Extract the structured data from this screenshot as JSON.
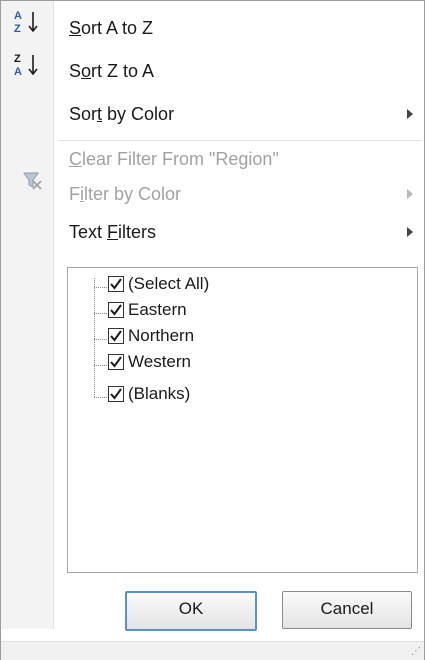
{
  "menu": {
    "sort_asc": {
      "label_pre": "",
      "mnemonic": "S",
      "label_post": "ort A to Z",
      "icon_top": "A",
      "icon_bottom": "Z"
    },
    "sort_desc": {
      "label_pre": "S",
      "mnemonic": "o",
      "label_post": "rt Z to A",
      "icon_top": "Z",
      "icon_bottom": "A"
    },
    "sort_color": {
      "label_pre": "Sor",
      "mnemonic": "t",
      "label_post": " by Color"
    },
    "clear_filter": {
      "label_pre": "",
      "mnemonic": "C",
      "label_post": "lear Filter From \"Region\""
    },
    "filter_color": {
      "label_pre": "F",
      "mnemonic": "i",
      "label_post": "lter by Color"
    },
    "text_filters": {
      "label_pre": "Text ",
      "mnemonic": "F",
      "label_post": "ilters"
    }
  },
  "filter_list": {
    "items": [
      {
        "label": "(Select All)",
        "checked": true
      },
      {
        "label": "Eastern",
        "checked": true
      },
      {
        "label": "Northern",
        "checked": true
      },
      {
        "label": "Western",
        "checked": true
      },
      {
        "label": "(Blanks)",
        "checked": true
      }
    ]
  },
  "buttons": {
    "ok": "OK",
    "cancel": "Cancel"
  },
  "icons": {
    "sort_asc": "sort-ascending-icon",
    "sort_desc": "sort-descending-icon",
    "clear_filter": "clear-filter-icon",
    "submenu": "submenu-arrow-icon"
  },
  "colors": {
    "sort_blue": "#2f5aa6",
    "sort_arrow": "#1a1a1a",
    "disabled_text": "#a2a2a2",
    "ok_border": "#5c8fd0"
  }
}
